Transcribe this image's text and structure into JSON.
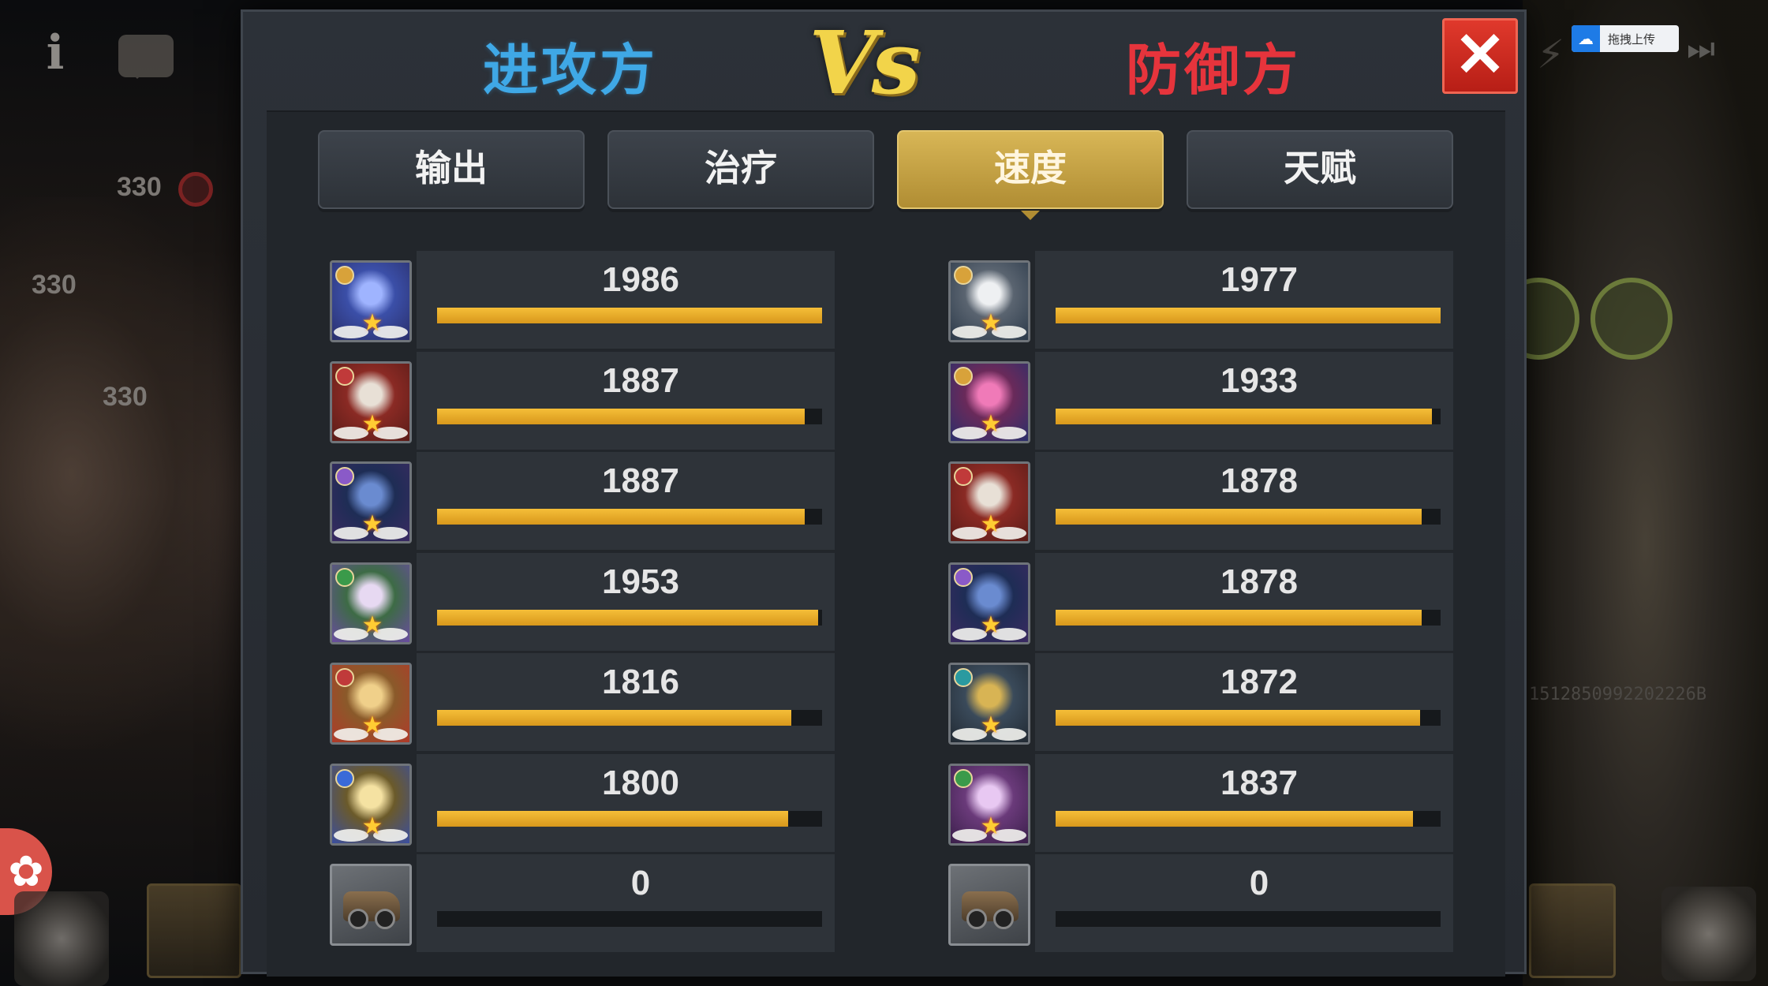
{
  "hud": {
    "info_icon": "info-icon",
    "chat_icon": "chat-icon",
    "left_values": [
      "330",
      "330",
      "330"
    ],
    "upload_label": "拖拽上传",
    "background_id_text": "1512850992202226B"
  },
  "dialog": {
    "attacker_title": "进攻方",
    "vs_text": "Vs",
    "defender_title": "防御方",
    "close_label": "✕",
    "tabs": [
      {
        "label": "输出",
        "active": false
      },
      {
        "label": "治疗",
        "active": false
      },
      {
        "label": "速度",
        "active": true
      },
      {
        "label": "天赋",
        "active": false
      }
    ],
    "bar_color": "#f0b52c",
    "max_value": 2000
  },
  "attackers": [
    {
      "value": "1986",
      "fill": 1.0,
      "portrait": "blue-haired-sorceress",
      "faction": "yellow"
    },
    {
      "value": "1887",
      "fill": 0.955,
      "portrait": "white-bearded-warrior",
      "faction": "red"
    },
    {
      "value": "1887",
      "fill": 0.955,
      "portrait": "dark-dragon-beast",
      "faction": "purple"
    },
    {
      "value": "1953",
      "fill": 0.99,
      "portrait": "green-fairy-maiden",
      "faction": "green"
    },
    {
      "value": "1816",
      "fill": 0.92,
      "portrait": "blonde-valkyrie",
      "faction": "red"
    },
    {
      "value": "1800",
      "fill": 0.912,
      "portrait": "golden-haired-priestess",
      "faction": "blue"
    },
    {
      "value": "0",
      "fill": 0,
      "portrait": "war-vehicle",
      "faction": "none"
    }
  ],
  "defenders": [
    {
      "value": "1977",
      "fill": 1.0,
      "portrait": "white-haired-goddess",
      "faction": "yellow"
    },
    {
      "value": "1933",
      "fill": 0.978,
      "portrait": "pink-haired-sorceress",
      "faction": "yellow"
    },
    {
      "value": "1878",
      "fill": 0.95,
      "portrait": "white-bearded-warrior",
      "faction": "red"
    },
    {
      "value": "1878",
      "fill": 0.95,
      "portrait": "dark-dragon-beast",
      "faction": "purple"
    },
    {
      "value": "1872",
      "fill": 0.947,
      "portrait": "masked-golem",
      "faction": "teal"
    },
    {
      "value": "1837",
      "fill": 0.929,
      "portrait": "purple-demoness",
      "faction": "green"
    },
    {
      "value": "0",
      "fill": 0,
      "portrait": "war-vehicle",
      "faction": "none"
    }
  ]
}
